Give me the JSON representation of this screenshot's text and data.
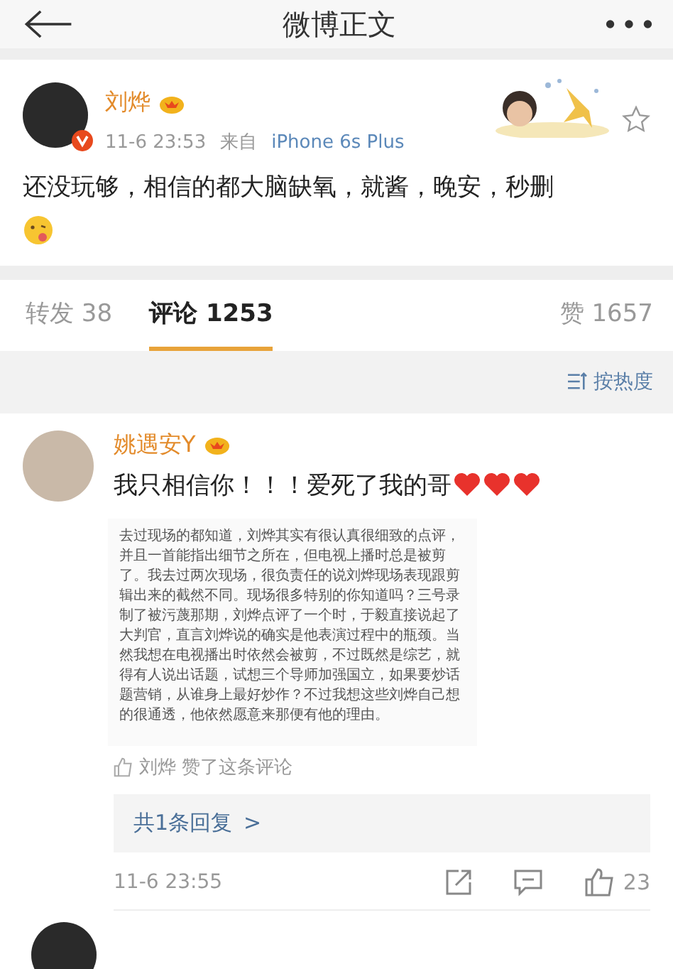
{
  "header": {
    "title": "微博正文"
  },
  "post": {
    "author": "刘烨",
    "time": "11-6 23:53",
    "source_prefix": "来自",
    "source": "iPhone 6s Plus",
    "text": "还没玩够，相信的都大脑缺氧，就酱，晚安，秒删"
  },
  "tabs": [
    {
      "label": "转发 38",
      "selected": false
    },
    {
      "label": "评论 1253",
      "selected": true
    },
    {
      "label": "赞 1657",
      "selected": false
    }
  ],
  "sort": {
    "label": "按热度"
  },
  "comments": [
    {
      "author": "姚遇安Y",
      "text": "我只相信你！！！爱死了我的哥",
      "image_text": "去过现场的都知道，刘烨其实有很认真很细致的点评，并且一首能指出细节之所在，但电视上播时总是被剪了。我去过两次现场，很负责任的说刘烨现场表现跟剪辑出来的截然不同。现场很多特别的你知道吗？三号录制了被污蔑那期，刘烨点评了一个时，于毅直接说起了大判官，直言刘烨说的确实是他表演过程中的瓶颈。当然我想在电视播出时依然会被剪，不过既然是综艺，就得有人说出话题，试想三个导师加强国立，如果要炒话题营销，从谁身上最好炒作？不过我想这些刘烨自己想的很通透，他依然愿意来那便有他的理由。",
      "liked": "刘烨 赞了这条评论",
      "replies": "共1条回复",
      "reply_arrow": ">",
      "time": "11-6 23:55",
      "likes": "23"
    }
  ]
}
